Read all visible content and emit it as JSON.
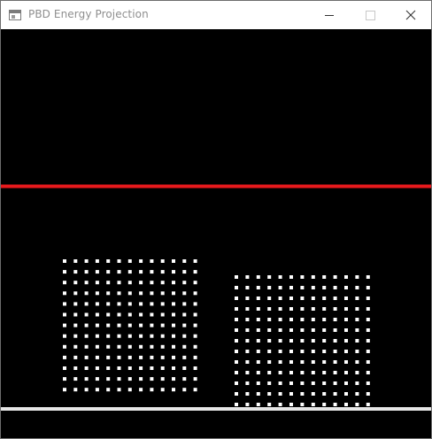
{
  "window": {
    "title": "PBD Energy Projection",
    "controls": {
      "minimize": "minimize-icon",
      "maximize": "maximize-icon",
      "close": "close-icon"
    }
  },
  "scene": {
    "background_color": "#000000",
    "threshold_line": {
      "color": "#e8191c"
    },
    "ground_line": {
      "color": "#e6e6e6"
    },
    "particle_color": "#ffffff",
    "blocks": [
      {
        "name": "left-block",
        "columns": 13,
        "rows": 13
      },
      {
        "name": "right-block",
        "columns": 13,
        "rows": 13
      }
    ]
  }
}
